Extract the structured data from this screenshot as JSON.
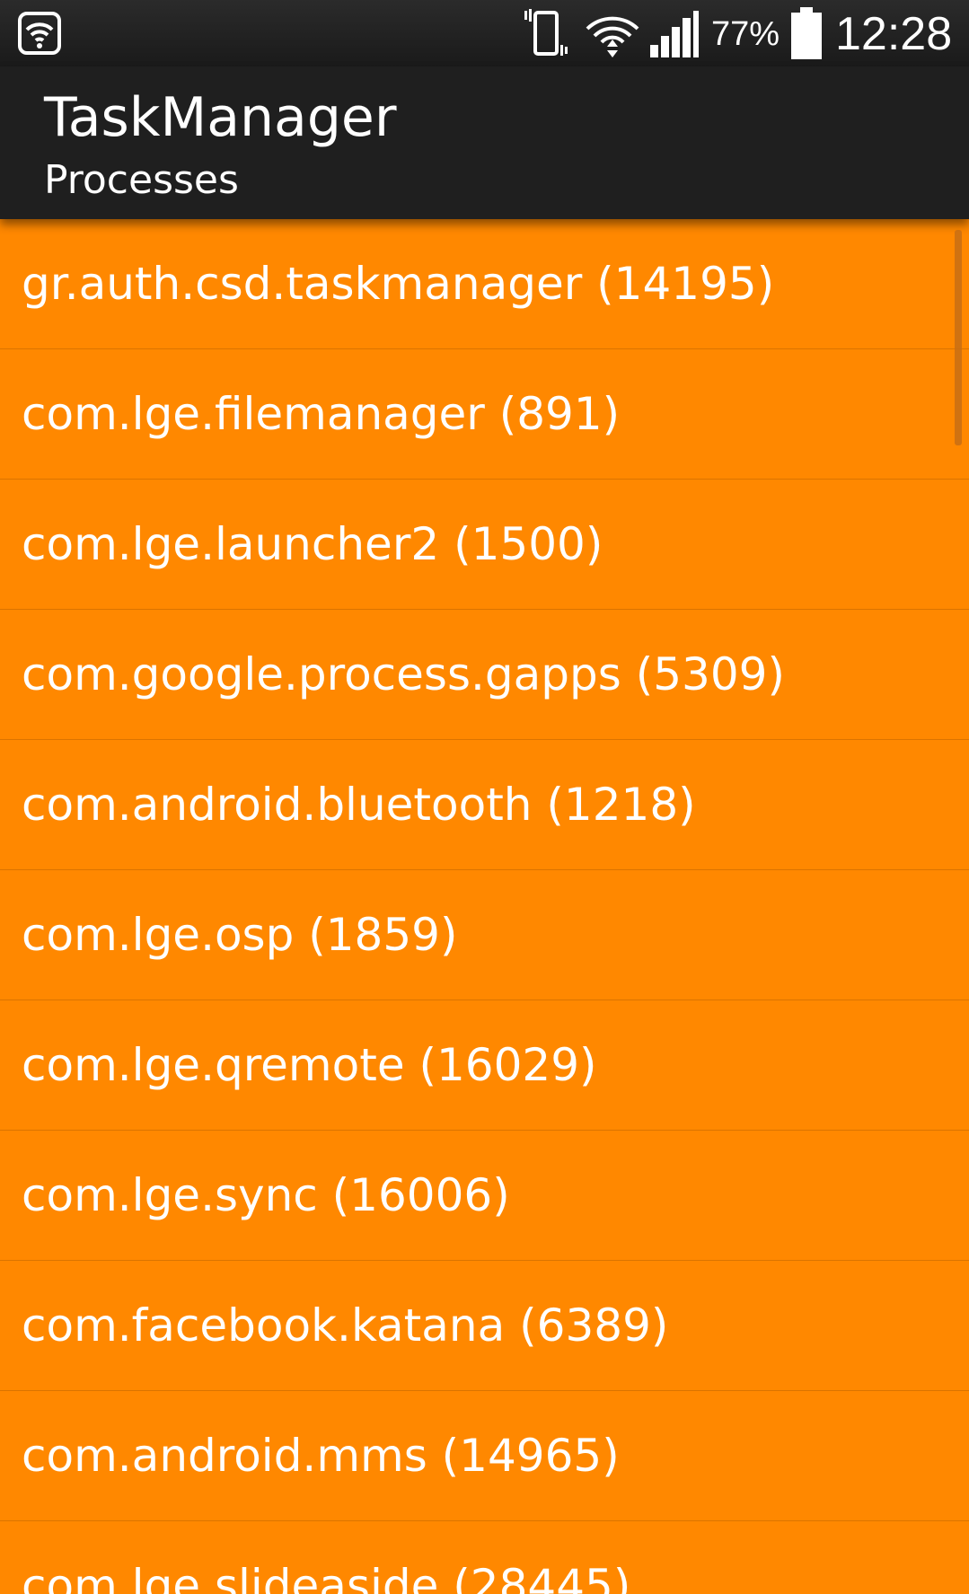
{
  "status_bar": {
    "left_icon": "wifi-hotspot-icon",
    "icons": [
      "vibrate-icon",
      "wifi-icon",
      "signal-icon",
      "battery-icon"
    ],
    "battery_text": "77%",
    "battery_level": 0.77,
    "time": "12:28"
  },
  "action_bar": {
    "title": "TaskManager",
    "subtitle": "Processes"
  },
  "processes": [
    {
      "label": "gr.auth.csd.taskmanager (14195)"
    },
    {
      "label": "com.lge.filemanager (891)"
    },
    {
      "label": "com.lge.launcher2 (1500)"
    },
    {
      "label": "com.google.process.gapps (5309)"
    },
    {
      "label": "com.android.bluetooth (1218)"
    },
    {
      "label": "com.lge.osp (1859)"
    },
    {
      "label": "com.lge.qremote (16029)"
    },
    {
      "label": "com.lge.sync (16006)"
    },
    {
      "label": "com.facebook.katana (6389)"
    },
    {
      "label": "com.android.mms (14965)"
    },
    {
      "label": "com.lge.slideaside (28445)"
    }
  ],
  "colors": {
    "list_background": "#ff8800",
    "action_bar": "#1f1f1f",
    "status_bar": "#1a1a1a",
    "text": "#ffffff"
  }
}
